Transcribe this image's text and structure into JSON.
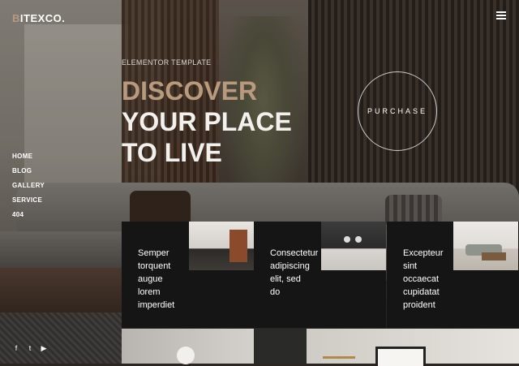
{
  "brand": {
    "logo_first": "B",
    "logo_rest": "ITEXCO."
  },
  "nav": {
    "items": [
      "HOME",
      "BLOG",
      "GALLERY",
      "SERVICE",
      "404"
    ]
  },
  "hero": {
    "eyebrow": "ELEMENTOR TEMPLATE",
    "line1": "DISCOVER",
    "line2": "YOUR PLACE",
    "line3": "TO LIVE",
    "purchase_label": "PURCHASE"
  },
  "cards": [
    {
      "text_lines": [
        "Semper",
        "torquent",
        "augue",
        "lorem",
        "imperdiet"
      ]
    },
    {
      "text_lines": [
        "Consectetur",
        "adipiscing",
        "elit, sed",
        "do"
      ]
    },
    {
      "text_lines": [
        "Excepteur",
        "sint",
        "occaecat",
        "cupidatat",
        "proident"
      ]
    }
  ],
  "social": {
    "icons": [
      "facebook-icon",
      "twitter-icon",
      "youtube-icon"
    ],
    "glyphs": [
      "f",
      "t",
      "▶"
    ]
  },
  "colors": {
    "accent": "#b89b7e",
    "card_bg": "#151515",
    "text": "#ffffff"
  }
}
